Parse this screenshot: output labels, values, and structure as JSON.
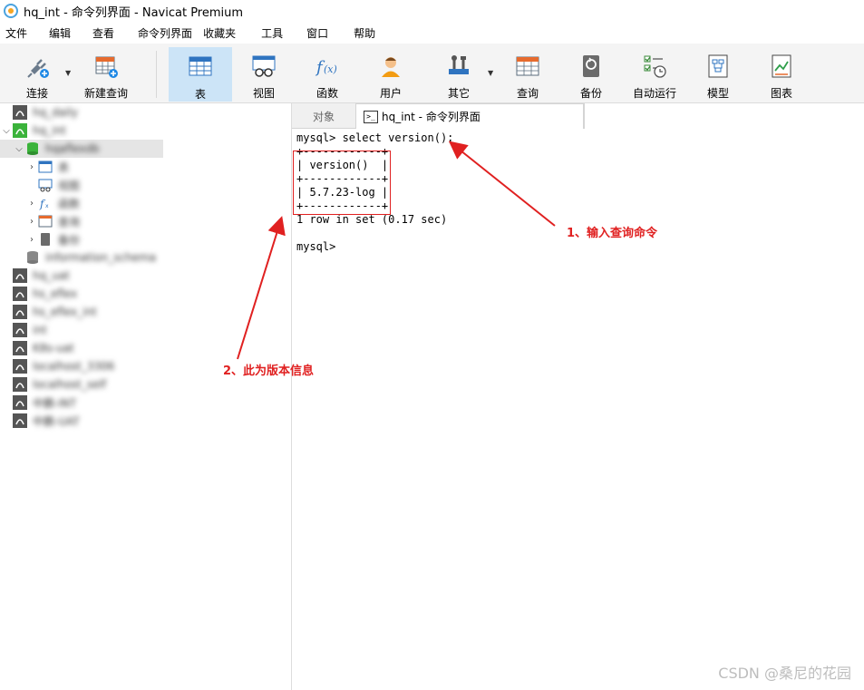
{
  "window": {
    "title": "hq_int - 命令列界面 - Navicat Premium"
  },
  "menu": [
    "文件",
    "编辑",
    "查看",
    "命令列界面",
    "收藏夹",
    "工具",
    "窗口",
    "帮助"
  ],
  "toolbar": {
    "connect": "连接",
    "new_query": "新建查询",
    "table": "表",
    "view": "视图",
    "function": "函数",
    "user": "用户",
    "other": "其它",
    "query": "查询",
    "backup": "备份",
    "auto_run": "自动运行",
    "model": "模型",
    "chart": "图表"
  },
  "sidebar": {
    "items": [
      {
        "label": "hq_daily"
      },
      {
        "label": "hq_int"
      },
      {
        "label": "hqaflexdb"
      },
      {
        "label": "表"
      },
      {
        "label": "视图"
      },
      {
        "label": "函数"
      },
      {
        "label": "查询"
      },
      {
        "label": "备份"
      },
      {
        "label": "information_schema"
      },
      {
        "label": "hq_uat"
      },
      {
        "label": "hs_eflex"
      },
      {
        "label": "hs_eflex_int"
      },
      {
        "label": "int"
      },
      {
        "label": "K8s-uat"
      },
      {
        "label": "localhost_3306"
      },
      {
        "label": "localhost_self"
      },
      {
        "label": "中鹏-INT"
      },
      {
        "label": "中鹏-UAT"
      }
    ]
  },
  "tabs": {
    "objects": "对象",
    "console": "hq_int - 命令列界面"
  },
  "console": {
    "lines": [
      "mysql> select version();",
      "+------------+",
      "| version()  |",
      "+------------+",
      "| 5.7.23-log |",
      "+------------+",
      "1 row in set (0.17 sec)",
      "",
      "mysql>"
    ]
  },
  "annotations": {
    "first": "1、输入查询命令",
    "second": "2、此为版本信息"
  },
  "watermark": "CSDN @桑尼的花园",
  "colors": {
    "accent_red": "#e02020",
    "active_tool": "#cce4f7",
    "conn_green": "#3bb33b"
  }
}
